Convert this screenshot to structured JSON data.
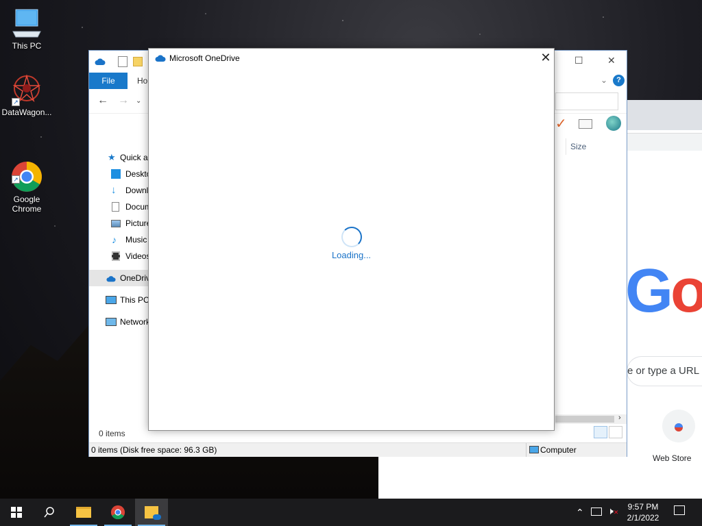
{
  "desktop": {
    "icons": [
      {
        "label": "This PC"
      },
      {
        "label": "DataWagon..."
      },
      {
        "label": "Google\nChrome"
      }
    ]
  },
  "explorer": {
    "ribbon": {
      "file_tab": "File",
      "home_tab": "Ho"
    },
    "sidebar": [
      {
        "label": "Quick a"
      },
      {
        "label": "Deskto"
      },
      {
        "label": "Downl"
      },
      {
        "label": "Docum"
      },
      {
        "label": "Picture"
      },
      {
        "label": "Music"
      },
      {
        "label": "Videos"
      },
      {
        "label": "OneDriv"
      },
      {
        "label": "This PC"
      },
      {
        "label": "Network"
      }
    ],
    "column_size": "Size",
    "items_count": "0 items",
    "status_left": "0 items (Disk free space: 96.3 GB)",
    "status_right": "Computer"
  },
  "onedrive": {
    "title": "Microsoft OneDrive",
    "close": "✕",
    "loading": "Loading..."
  },
  "chrome": {
    "logo": [
      "G",
      "o"
    ],
    "search_placeholder": "e or type a URL",
    "webstore": "Web Store"
  },
  "taskbar": {
    "time": "9:57 PM",
    "date": "2/1/2022"
  },
  "colors": {
    "accent": "#1979ca",
    "onedrive_blue": "#1a73c8",
    "taskbar": "#1b1b1d"
  }
}
